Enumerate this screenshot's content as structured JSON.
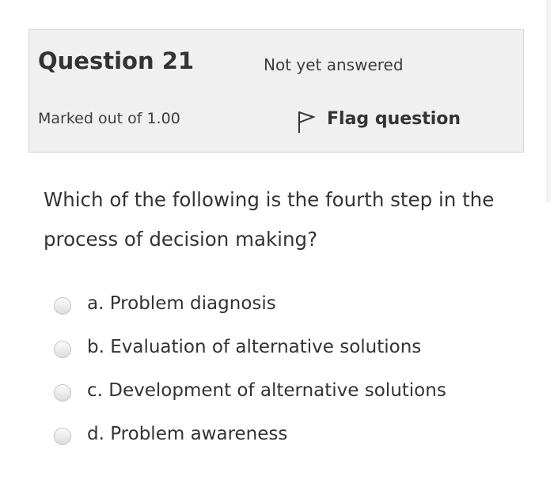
{
  "question": {
    "title": "Question 21",
    "status": "Not yet answered",
    "marks": "Marked out of 1.00",
    "flag_label": "Flag question",
    "flag_icon": "flag-outline-icon",
    "text": "Which of the following is the fourth step in the process of decision making?"
  },
  "answers": [
    {
      "label": "a. Problem diagnosis",
      "selected": false
    },
    {
      "label": "b. Evaluation of alternative solutions",
      "selected": false
    },
    {
      "label": "c. Development of alternative solutions",
      "selected": false
    },
    {
      "label": "d. Problem awareness",
      "selected": false
    }
  ],
  "colors": {
    "info_background": "#f0f0f0",
    "info_border": "#d6d6d6",
    "text": "#333333"
  }
}
